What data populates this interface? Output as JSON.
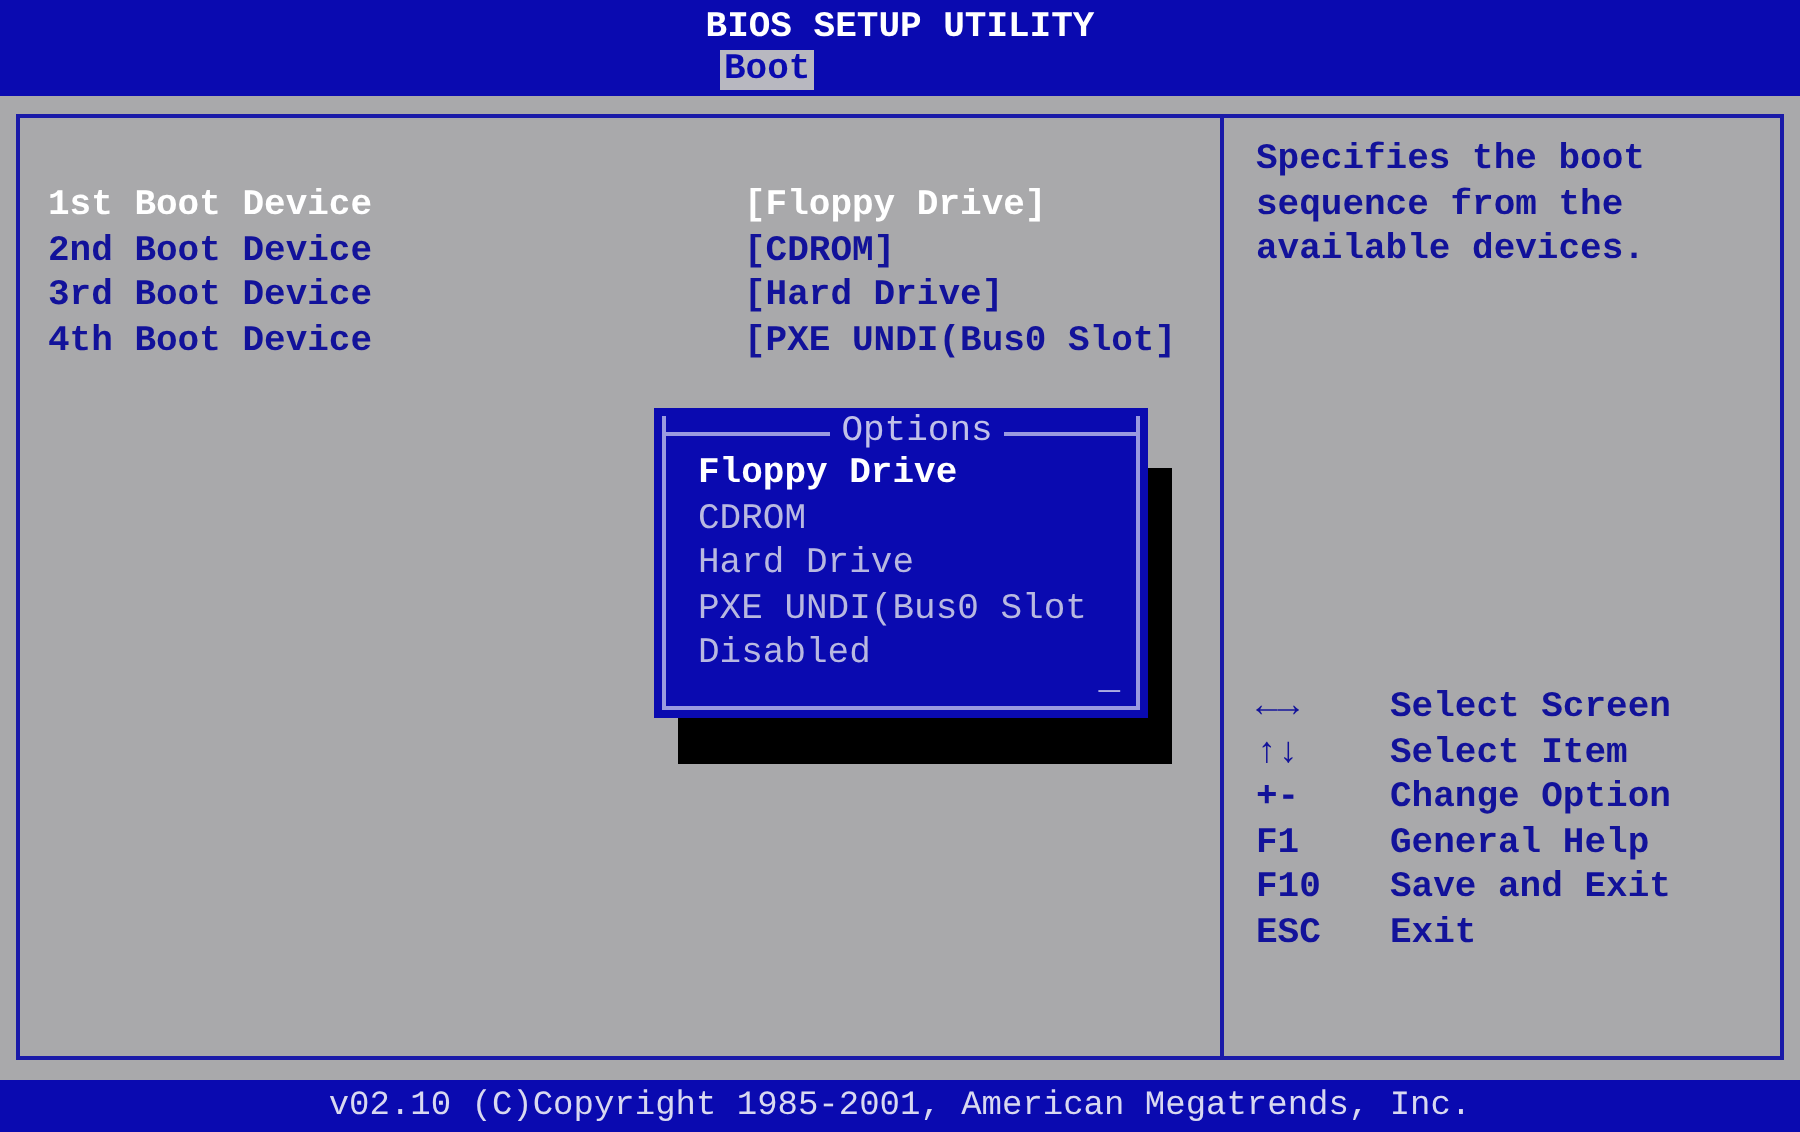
{
  "header": {
    "title": "BIOS SETUP UTILITY",
    "tabs": [
      {
        "label": "Boot",
        "selected": true
      }
    ]
  },
  "settings": [
    {
      "label": "1st Boot Device",
      "value": "[Floppy Drive]",
      "selected": true
    },
    {
      "label": "2nd Boot Device",
      "value": "[CDROM]",
      "selected": false
    },
    {
      "label": "3rd Boot Device",
      "value": "[Hard Drive]",
      "selected": false
    },
    {
      "label": "4th Boot Device",
      "value": "[PXE UNDI(Bus0 Slot]",
      "selected": false
    }
  ],
  "options_popup": {
    "title": "Options",
    "items": [
      {
        "label": "Floppy Drive",
        "selected": true
      },
      {
        "label": "CDROM",
        "selected": false
      },
      {
        "label": "Hard Drive",
        "selected": false
      },
      {
        "label": "PXE UNDI(Bus0 Slot",
        "selected": false
      },
      {
        "label": "Disabled",
        "selected": false
      }
    ],
    "cursor": "_"
  },
  "help_text": "Specifies the boot sequence from the available devices.",
  "key_legend": [
    {
      "key": "←→",
      "action": "Select Screen"
    },
    {
      "key": "↑↓",
      "action": "Select Item"
    },
    {
      "key": "+-",
      "action": "Change Option"
    },
    {
      "key": "F1",
      "action": "General Help"
    },
    {
      "key": "F10",
      "action": "Save and Exit"
    },
    {
      "key": "ESC",
      "action": "Exit"
    }
  ],
  "footer": "v02.10 (C)Copyright 1985-2001, American Megatrends, Inc."
}
